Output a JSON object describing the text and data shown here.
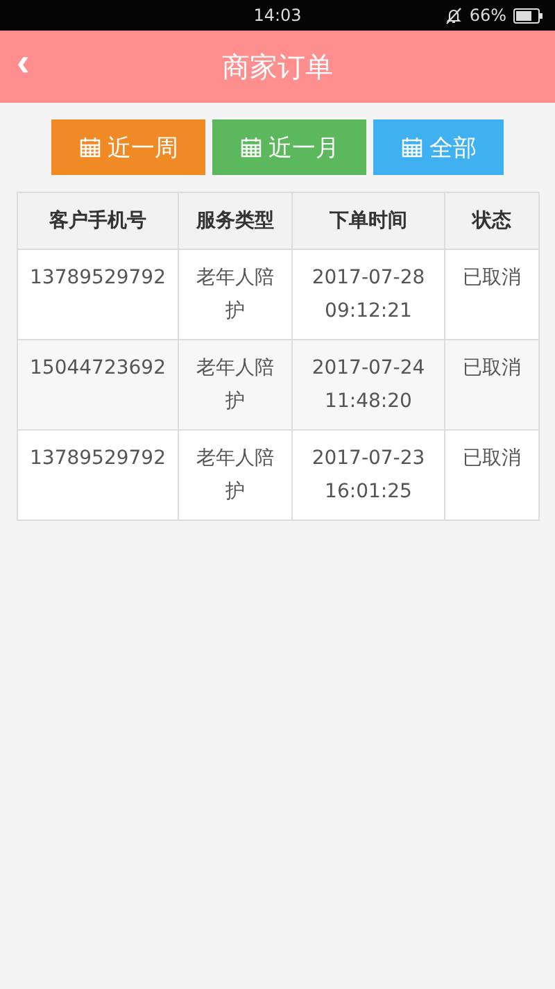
{
  "status_bar": {
    "time": "14:03",
    "battery": "66%"
  },
  "header": {
    "back": "‹",
    "title": "商家订单"
  },
  "filters": [
    {
      "label": "近一周",
      "color": "#f08a24"
    },
    {
      "label": "近一月",
      "color": "#5cb85c"
    },
    {
      "label": "全部",
      "color": "#3fb0f0"
    }
  ],
  "table": {
    "columns": [
      "客户手机号",
      "服务类型",
      "下单时间",
      "状态"
    ],
    "rows": [
      [
        "13789529792",
        "老年人陪护",
        "2017-07-28 09:12:21",
        "已取消"
      ],
      [
        "15044723692",
        "老年人陪护",
        "2017-07-24 11:48:20",
        "已取消"
      ],
      [
        "13789529792",
        "老年人陪护",
        "2017-07-23 16:01:25",
        "已取消"
      ]
    ]
  }
}
